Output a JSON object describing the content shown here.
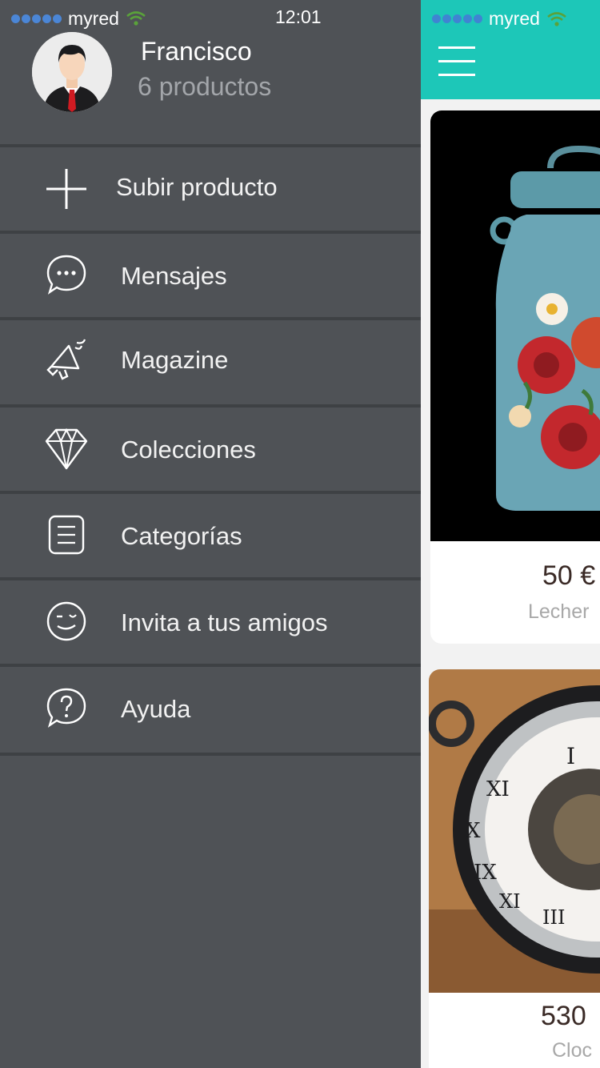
{
  "status_bar": {
    "carrier": "myred",
    "time": "12:01"
  },
  "user": {
    "name": "Francisco",
    "product_count": "6 productos"
  },
  "menu": [
    {
      "label": "Subir producto",
      "icon": "plus-icon"
    },
    {
      "label": "Mensajes",
      "icon": "chat-bubble-icon"
    },
    {
      "label": "Magazine",
      "icon": "megaphone-icon"
    },
    {
      "label": "Colecciones",
      "icon": "diamond-icon"
    },
    {
      "label": "Categorías",
      "icon": "list-icon"
    },
    {
      "label": "Invita a tus amigos",
      "icon": "wink-face-icon"
    },
    {
      "label": "Ayuda",
      "icon": "help-bubble-icon"
    }
  ],
  "feed": {
    "status_carrier": "myred",
    "products": [
      {
        "price": "50 €",
        "name": "Lecher"
      },
      {
        "price": "530",
        "name": "Cloc"
      }
    ]
  },
  "colors": {
    "drawer_bg": "#4f5256",
    "accent": "#1dc7b8",
    "divider": "#3e4144"
  }
}
